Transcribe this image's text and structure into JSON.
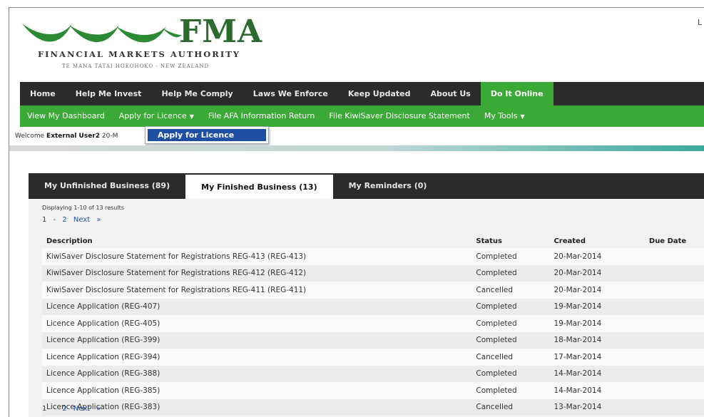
{
  "header": {
    "logo_text": "FMA",
    "org_name": "FINANCIAL MARKETS AUTHORITY",
    "org_subtitle": "TE MANA TATAI HOKOHOKO - NEW ZEALAND",
    "corner_link": "L",
    "colors": {
      "brand_green": "#3aa935",
      "logo_green": "#2d6a2e"
    }
  },
  "mainnav": {
    "items": [
      {
        "label": "Home"
      },
      {
        "label": "Help Me Invest"
      },
      {
        "label": "Help Me Comply"
      },
      {
        "label": "Laws We Enforce"
      },
      {
        "label": "Keep Updated"
      },
      {
        "label": "About Us"
      },
      {
        "label": "Do It Online"
      }
    ],
    "active": "Do It Online"
  },
  "subnav": {
    "items": [
      {
        "label": "View My Dashboard"
      },
      {
        "label": "Apply for Licence"
      },
      {
        "label": "File AFA Information Return"
      },
      {
        "label": "File KiwiSaver Disclosure Statement"
      },
      {
        "label": "My Tools"
      }
    ]
  },
  "dropdown": {
    "option": "Apply for Licence"
  },
  "welcome": {
    "prefix": "Welcome",
    "user": "External User2",
    "suffix": "20-M"
  },
  "tabs": [
    {
      "label": "My Unfinished Business (89)"
    },
    {
      "label": "My Finished Business (13)"
    },
    {
      "label": "My Reminders (0)"
    }
  ],
  "active_tab": "My Finished Business (13)",
  "results": {
    "display_text": "Displaying 1-10 of 13 results",
    "pager": {
      "current": "1",
      "page2": "2",
      "next": "Next »"
    },
    "columns": {
      "description": "Description",
      "status": "Status",
      "created": "Created",
      "due": "Due Date"
    },
    "rows": [
      {
        "description": "KiwiSaver Disclosure Statement for Registrations REG-413 (REG-413)",
        "status": "Completed",
        "created": "20-Mar-2014",
        "due": ""
      },
      {
        "description": "KiwiSaver Disclosure Statement for Registrations REG-412 (REG-412)",
        "status": "Completed",
        "created": "20-Mar-2014",
        "due": ""
      },
      {
        "description": "KiwiSaver Disclosure Statement for Registrations REG-411 (REG-411)",
        "status": "Cancelled",
        "created": "20-Mar-2014",
        "due": ""
      },
      {
        "description": "Licence Application (REG-407)",
        "status": "Completed",
        "created": "19-Mar-2014",
        "due": ""
      },
      {
        "description": "Licence Application (REG-405)",
        "status": "Completed",
        "created": "19-Mar-2014",
        "due": ""
      },
      {
        "description": "Licence Application (REG-399)",
        "status": "Completed",
        "created": "18-Mar-2014",
        "due": ""
      },
      {
        "description": "Licence Application (REG-394)",
        "status": "Cancelled",
        "created": "17-Mar-2014",
        "due": ""
      },
      {
        "description": "Licence Application (REG-388)",
        "status": "Completed",
        "created": "14-Mar-2014",
        "due": ""
      },
      {
        "description": "Licence Application (REG-385)",
        "status": "Completed",
        "created": "14-Mar-2014",
        "due": ""
      },
      {
        "description": "Licence Application (REG-383)",
        "status": "Cancelled",
        "created": "13-Mar-2014",
        "due": ""
      }
    ]
  }
}
